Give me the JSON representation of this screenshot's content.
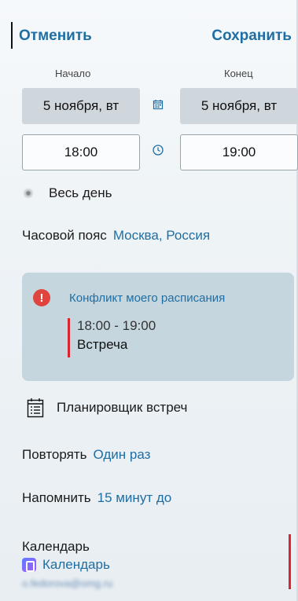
{
  "header": {
    "cancel": "Отменить",
    "save": "Сохранить"
  },
  "labels": {
    "start": "Начало",
    "end": "Конец"
  },
  "start": {
    "date": "5 ноября, вт",
    "time": "18:00"
  },
  "end": {
    "date": "5 ноября, вт",
    "time": "19:00"
  },
  "all_day": {
    "label": "Весь день"
  },
  "timezone": {
    "label": "Часовой пояс",
    "value": "Москва, Россия"
  },
  "conflict": {
    "title": "Конфликт моего расписания",
    "time": "18:00 - 19:00",
    "event": "Встреча"
  },
  "planner": {
    "label": "Планировщик встреч"
  },
  "repeat": {
    "label": "Повторять",
    "value": "Один раз"
  },
  "remind": {
    "label": "Напомнить",
    "value": "15 минут до"
  },
  "calendar": {
    "label": "Календарь",
    "value": "Календарь",
    "email": "o.fedorova@omg.ru"
  },
  "colors": {
    "accent": "#1f6ea3",
    "alert": "#e0443e",
    "conflict_bg": "#c5d6df"
  },
  "icons": {
    "calendar": "calendar-icon",
    "clock": "clock-icon",
    "warning": "warning-icon",
    "planner": "planner-icon"
  }
}
